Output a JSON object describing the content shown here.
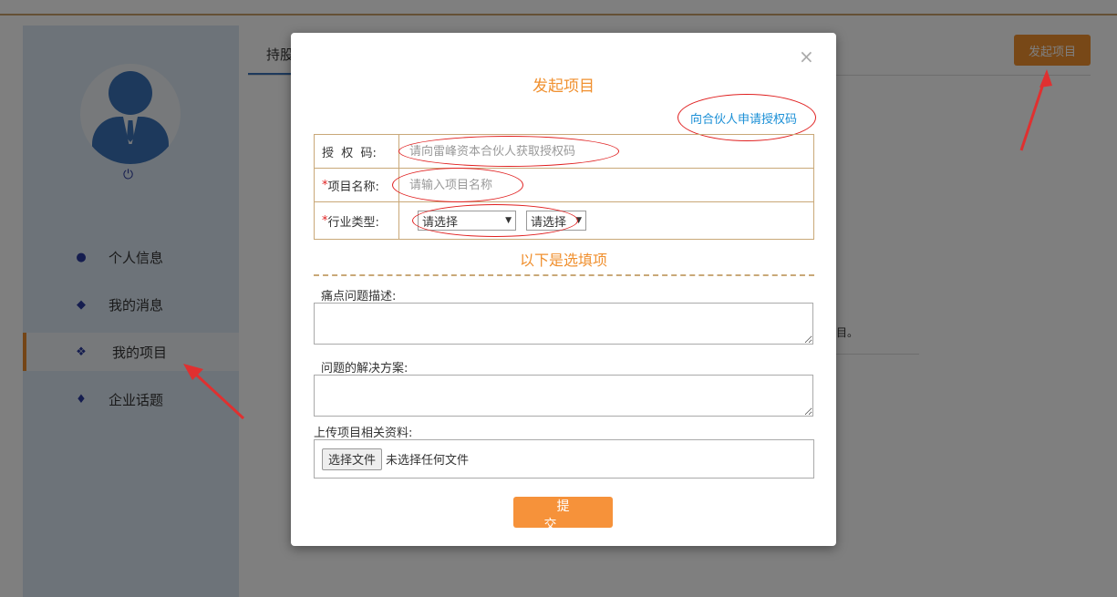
{
  "header": {
    "launch_button": "发起项目"
  },
  "sidebar": {
    "items": [
      {
        "label": "个人信息",
        "icon": "user-icon"
      },
      {
        "label": "我的消息",
        "icon": "comments-icon"
      },
      {
        "label": "我的项目",
        "icon": "cubes-icon",
        "active": true
      },
      {
        "label": "企业话题",
        "icon": "fire-icon"
      }
    ]
  },
  "main": {
    "tab_partial": "持股",
    "list_text": "项目。"
  },
  "modal": {
    "title": "发起项目",
    "close_glyph": "×",
    "apply_link": "向合伙人申请授权码",
    "auth_code_label": "授  权  码:",
    "auth_code_placeholder": "请向雷峰资本合伙人获取授权码",
    "project_name_label": "项目名称:",
    "project_name_placeholder": "请输入项目名称",
    "industry_label": "行业类型:",
    "industry_select_1": "请选择",
    "industry_select_2": "请选择",
    "required_mark": "*",
    "optional_title": "以下是选填项",
    "pain_point_label": "痛点问题描述:",
    "solution_label": "问题的解决方案:",
    "upload_label": "上传项目相关资料:",
    "file_button": "选择文件",
    "file_status": "未选择任何文件",
    "submit": "提交"
  },
  "colors": {
    "accent": "#f0902f",
    "link": "#1a8fd6",
    "annotation": "#e02020"
  }
}
